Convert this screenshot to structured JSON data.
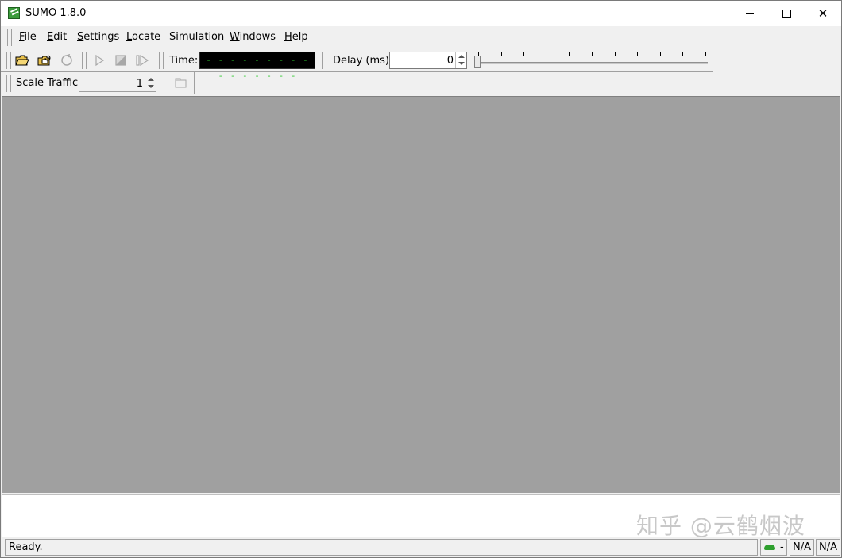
{
  "window": {
    "title": "SUMO 1.8.0",
    "minimize_glyph": "",
    "maximize_glyph": "",
    "close_glyph": "✕"
  },
  "menu": {
    "items": [
      {
        "label": "File",
        "accel": "F",
        "rest": "ile"
      },
      {
        "label": "Edit",
        "accel": "E",
        "rest": "dit"
      },
      {
        "label": "Settings",
        "accel": "S",
        "rest": "ettings"
      },
      {
        "label": "Locate",
        "accel": "L",
        "rest": "ocate"
      },
      {
        "label": "Simulation",
        "accel": "",
        "rest": "Simulation"
      },
      {
        "label": "Windows",
        "accel": "W",
        "rest": "indows"
      },
      {
        "label": "Help",
        "accel": "H",
        "rest": "elp"
      }
    ]
  },
  "toolbar": {
    "open_icon": "open-folder-icon",
    "reload_icon": "reload-network-icon",
    "reload_sim_icon": "reload-simulation-icon",
    "run_icon": "play-icon",
    "stop_icon": "stop-icon",
    "step_icon": "step-icon",
    "time_label": "Time:",
    "time_value": "- - - - - - - - - - - - - - - -",
    "delay_label": "Delay (ms):",
    "delay_value": "0",
    "delay_slider_level": 0
  },
  "toolbar2": {
    "scale_label": "Scale Traffic:",
    "scale_value": "1",
    "window_icon": "new-view-icon"
  },
  "status": {
    "text": "Ready.",
    "vehicle_count": "-",
    "cell1": "N/A",
    "cell2": "N/A"
  },
  "watermark": "知乎 @云鹤烟波"
}
